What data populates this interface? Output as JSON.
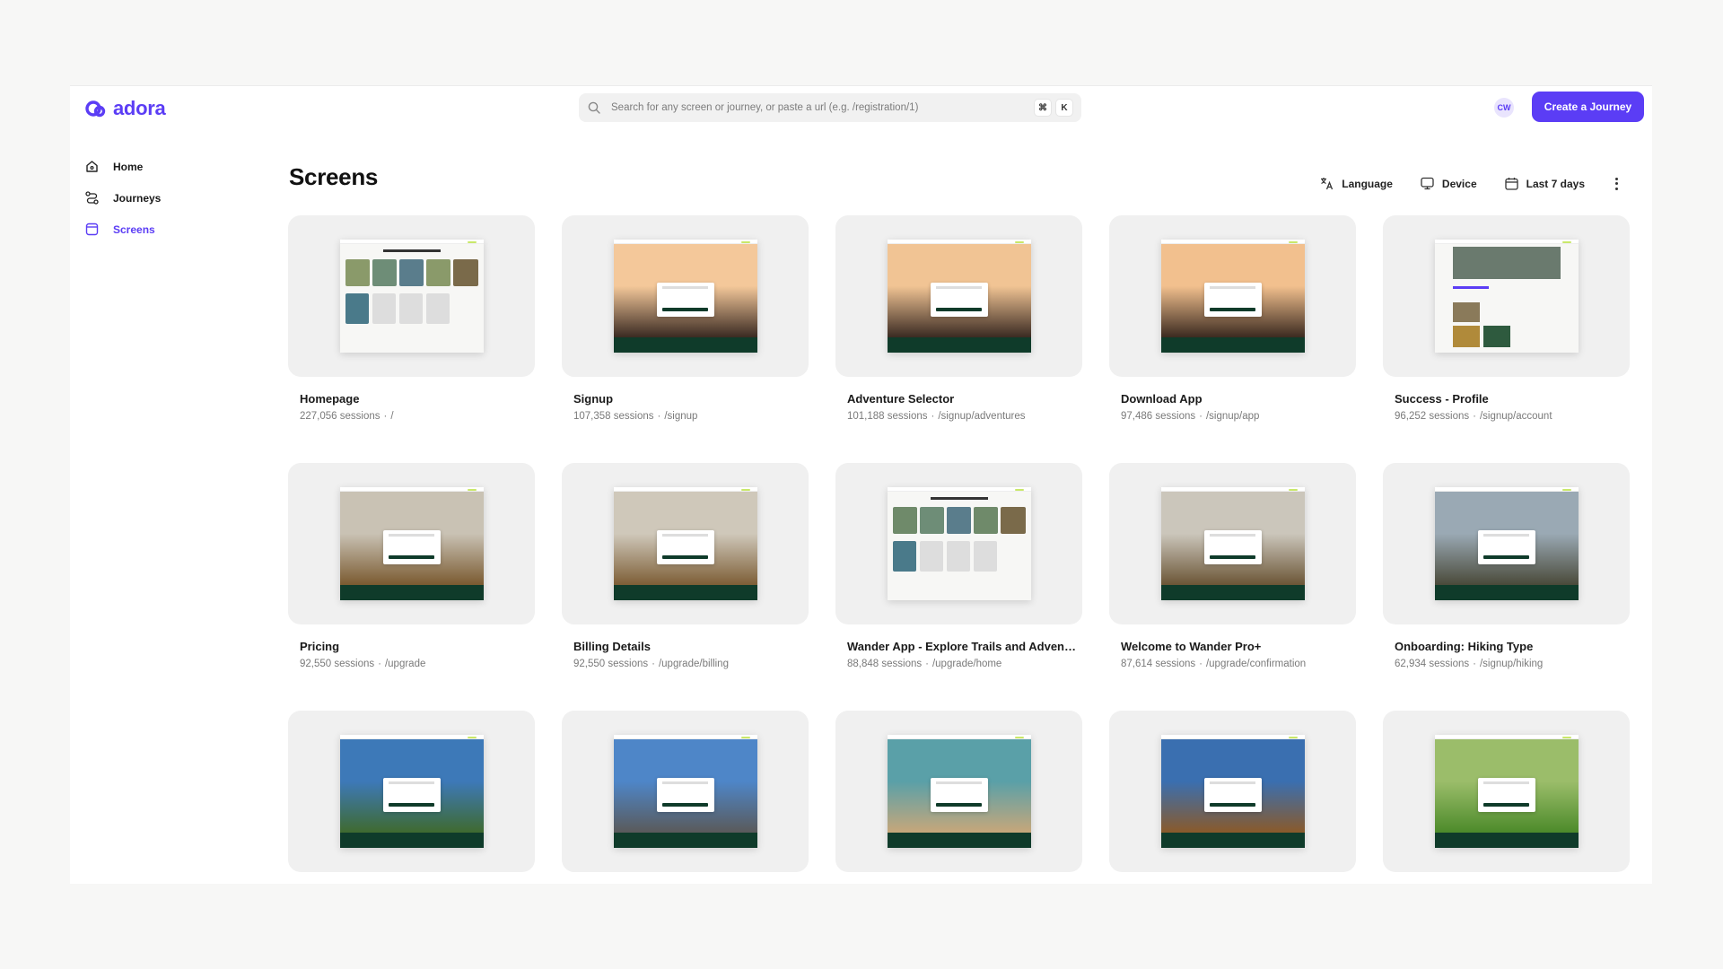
{
  "app": {
    "logo_text": "adora",
    "brand_color": "#5b3df5"
  },
  "search": {
    "placeholder": "Search for any screen or journey, or paste a url (e.g. /registration/1)",
    "shortcut_mod": "⌘",
    "shortcut_key": "K"
  },
  "user": {
    "initials": "CW"
  },
  "create_button": "Create a Journey",
  "sidebar": {
    "items": [
      {
        "label": "Home",
        "icon": "home-icon",
        "active": false
      },
      {
        "label": "Journeys",
        "icon": "journeys-icon",
        "active": false
      },
      {
        "label": "Screens",
        "icon": "screens-icon",
        "active": true
      }
    ]
  },
  "page": {
    "title": "Screens",
    "filters": {
      "language": "Language",
      "device": "Device",
      "date_range": "Last 7 days"
    }
  },
  "screens": [
    {
      "title": "Homepage",
      "sessions": "227,056 sessions",
      "path": "/",
      "style": "white",
      "tone": [
        "#e9e6e0",
        "#8a9a6a"
      ]
    },
    {
      "title": "Signup",
      "sessions": "107,358 sessions",
      "path": "/signup",
      "style": "sunset",
      "tone": [
        "#f4c89a",
        "#3a2a22"
      ]
    },
    {
      "title": "Adventure Selector",
      "sessions": "101,188 sessions",
      "path": "/signup/adventures",
      "style": "sunset",
      "tone": [
        "#f1c494",
        "#3a2a22"
      ]
    },
    {
      "title": "Download App",
      "sessions": "97,486 sessions",
      "path": "/signup/app",
      "style": "sunset",
      "tone": [
        "#f2c08e",
        "#3b2a20"
      ]
    },
    {
      "title": "Success - Profile",
      "sessions": "96,252 sessions",
      "path": "/signup/account",
      "style": "profile",
      "tone": [
        "#6a7a6e",
        "#2e5a3e"
      ]
    },
    {
      "title": "Pricing",
      "sessions": "92,550 sessions",
      "path": "/upgrade",
      "style": "desert",
      "tone": [
        "#c9c2b4",
        "#7a5a30"
      ]
    },
    {
      "title": "Billing Details",
      "sessions": "92,550 sessions",
      "path": "/upgrade/billing",
      "style": "desert",
      "tone": [
        "#cfc8ba",
        "#7d5e36"
      ]
    },
    {
      "title": "Wander App - Explore Trails and Adventures",
      "sessions": "88,848 sessions",
      "path": "/upgrade/home",
      "style": "white",
      "tone": [
        "#e9e6e0",
        "#6f8a6a"
      ]
    },
    {
      "title": "Welcome to Wander Pro+",
      "sessions": "87,614 sessions",
      "path": "/upgrade/confirmation",
      "style": "desert",
      "tone": [
        "#cbc6bb",
        "#6b5536"
      ]
    },
    {
      "title": "Onboarding: Hiking Type",
      "sessions": "62,934 sessions",
      "path": "/signup/hiking",
      "style": "mountain",
      "tone": [
        "#9aa9b4",
        "#4a4a3a"
      ]
    },
    {
      "title": "",
      "sessions": "",
      "path": "",
      "style": "alpine",
      "tone": [
        "#3d79b8",
        "#3f6a2f"
      ]
    },
    {
      "title": "",
      "sessions": "",
      "path": "",
      "style": "alpine",
      "tone": [
        "#4e86c8",
        "#5a5a5a"
      ]
    },
    {
      "title": "",
      "sessions": "",
      "path": "",
      "style": "teal",
      "tone": [
        "#5aa0a8",
        "#c7a77a"
      ]
    },
    {
      "title": "",
      "sessions": "",
      "path": "",
      "style": "alpine",
      "tone": [
        "#3a6fb0",
        "#8a5a2a"
      ]
    },
    {
      "title": "",
      "sessions": "",
      "path": "",
      "style": "meadow",
      "tone": [
        "#9bbd6a",
        "#4c8a2a"
      ]
    }
  ],
  "meta_separator": "·"
}
